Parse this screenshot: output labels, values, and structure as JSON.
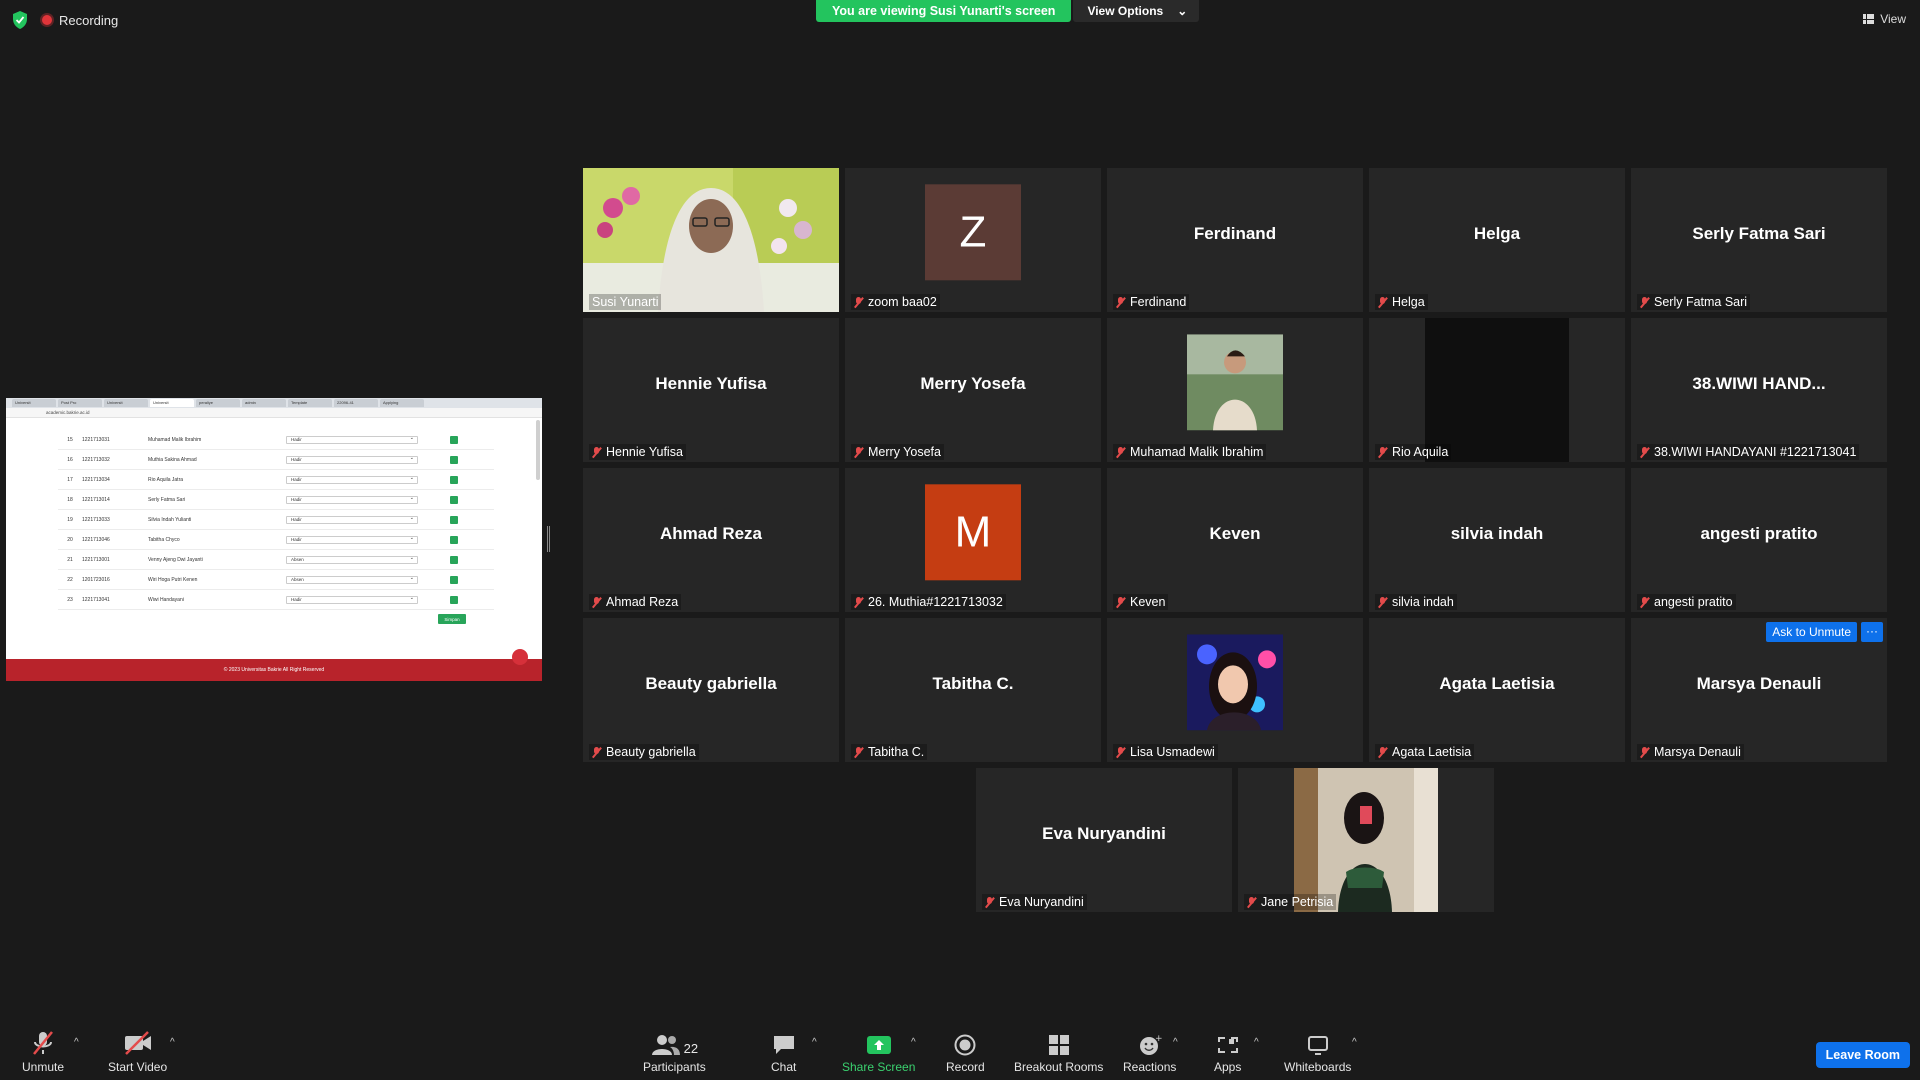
{
  "top": {
    "recording_label": "Recording",
    "viewing_banner": "You are viewing Susi Yunarti's screen",
    "view_options_label": "View Options",
    "view_label": "View"
  },
  "shared_screen": {
    "url": "academic.bakrie.ac.id",
    "tabs": [
      "Universit",
      "Post Pro",
      "Universit",
      "Universit",
      "peraliye",
      "admin",
      "Template",
      "22096-41",
      "Applying"
    ],
    "rows": [
      {
        "no": "15",
        "nim": "1221713031",
        "nama": "Muhamad Malik Ibrahim",
        "status": "Hadir"
      },
      {
        "no": "16",
        "nim": "1221713032",
        "nama": "Muthia Sakina Ahmad",
        "status": "Hadir"
      },
      {
        "no": "17",
        "nim": "1221713034",
        "nama": "Rio Aquila Jatra",
        "status": "Hadir"
      },
      {
        "no": "18",
        "nim": "1221713014",
        "nama": "Serly Fatma Sari",
        "status": "Hadir"
      },
      {
        "no": "19",
        "nim": "1221713033",
        "nama": "Silvia Indah Yulianti",
        "status": "Hadir"
      },
      {
        "no": "20",
        "nim": "1221713046",
        "nama": "Tabitha Chyco",
        "status": "Hadir"
      },
      {
        "no": "21",
        "nim": "1221713001",
        "nama": "Venny Ajeng Dwi Jayanti",
        "status": "Absen"
      },
      {
        "no": "22",
        "nim": "1201723016",
        "nama": "Wiri Hoga Putri Kenen",
        "status": "Absen"
      },
      {
        "no": "23",
        "nim": "1221713041",
        "nama": "Wiwi Handayani",
        "status": "Hadir"
      }
    ],
    "save_label": "Simpan",
    "footer": "© 2023 Universitas Bakrie All Right Reserved"
  },
  "participants": [
    {
      "label": "Susi Yunarti",
      "center": "",
      "type": "video-susi",
      "muted": false,
      "active": true
    },
    {
      "label": "zoom baa02",
      "center": "",
      "type": "avatar",
      "letter": "Z",
      "color": "#5b3b35",
      "muted": true
    },
    {
      "label": "Ferdinand",
      "center": "Ferdinand",
      "type": "name",
      "muted": true
    },
    {
      "label": "Helga",
      "center": "Helga",
      "type": "name",
      "muted": true
    },
    {
      "label": "Serly Fatma Sari",
      "center": "Serly Fatma Sari",
      "type": "name",
      "muted": true
    },
    {
      "label": "Hennie Yufisa",
      "center": "Hennie Yufisa",
      "type": "name",
      "muted": true
    },
    {
      "label": "Merry Yosefa",
      "center": "Merry Yosefa",
      "type": "name",
      "muted": true
    },
    {
      "label": "Muhamad Malik Ibrahim",
      "center": "",
      "type": "photo-malik",
      "muted": true
    },
    {
      "label": "Rio Aquila",
      "center": "",
      "type": "black",
      "muted": true
    },
    {
      "label": "38.WIWI HANDAYANI #1221713041",
      "center": "38.WIWI  HAND...",
      "type": "name",
      "muted": true
    },
    {
      "label": "Ahmad Reza",
      "center": "Ahmad Reza",
      "type": "name",
      "muted": true
    },
    {
      "label": "26. Muthia#1221713032",
      "center": "",
      "type": "avatar",
      "letter": "M",
      "color": "#c53d12",
      "muted": true
    },
    {
      "label": "Keven",
      "center": "Keven",
      "type": "name",
      "muted": true
    },
    {
      "label": "silvia indah",
      "center": "silvia indah",
      "type": "name",
      "muted": true
    },
    {
      "label": "angesti pratito",
      "center": "angesti pratito",
      "type": "name",
      "muted": true
    },
    {
      "label": "Beauty gabriella",
      "center": "Beauty gabriella",
      "type": "name",
      "muted": true
    },
    {
      "label": "Tabitha C.",
      "center": "Tabitha C.",
      "type": "name",
      "muted": true
    },
    {
      "label": "Lisa Usmadewi",
      "center": "",
      "type": "photo-lisa",
      "muted": true
    },
    {
      "label": "Agata Laetisia",
      "center": "Agata Laetisia",
      "type": "name",
      "muted": true
    },
    {
      "label": "Marsya Denauli",
      "center": "Marsya Denauli",
      "type": "name",
      "muted": true,
      "ask_unmute": "Ask to Unmute",
      "more": "···"
    },
    {
      "label": "Eva Nuryandini",
      "center": "Eva Nuryandini",
      "type": "name",
      "muted": true
    },
    {
      "label": "Jane Petrisia",
      "center": "",
      "type": "photo-jane",
      "muted": true
    }
  ],
  "toolbar": {
    "unmute": "Unmute",
    "start_video": "Start Video",
    "participants": "Participants",
    "participants_count": "22",
    "chat": "Chat",
    "share_screen": "Share Screen",
    "record": "Record",
    "breakout_rooms": "Breakout Rooms",
    "reactions": "Reactions",
    "apps": "Apps",
    "whiteboards": "Whiteboards",
    "leave_room": "Leave Room"
  },
  "colors": {
    "banner_green": "#23c45e",
    "active_border": "#e9e76a",
    "accent_blue": "#0e71eb",
    "share_green": "#23c45e",
    "muted_red": "#e34b4b"
  }
}
